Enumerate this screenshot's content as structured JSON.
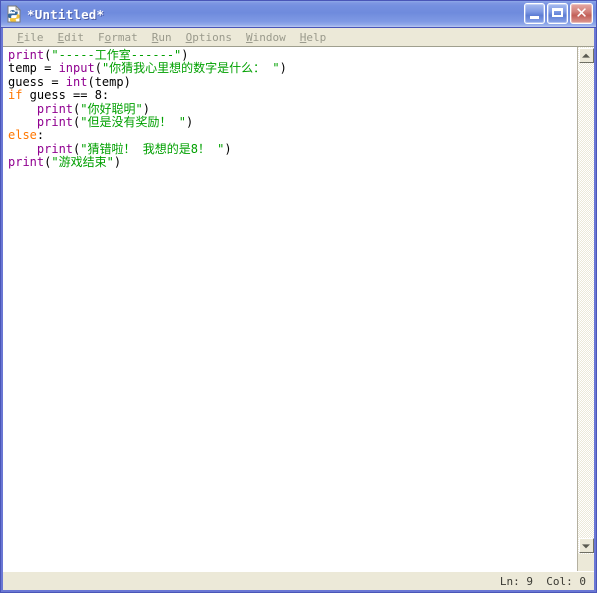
{
  "window": {
    "title": "*Untitled*",
    "icon": "python-idle-icon",
    "caption_buttons": [
      {
        "name": "minimize-button",
        "glyph": "_"
      },
      {
        "name": "maximize-button",
        "glyph": "□"
      },
      {
        "name": "close-button",
        "glyph": "✕"
      }
    ]
  },
  "menubar": {
    "items": [
      {
        "label": "File",
        "accel": "F"
      },
      {
        "label": "Edit",
        "accel": "E"
      },
      {
        "label": "Format",
        "accel": "o"
      },
      {
        "label": "Run",
        "accel": "R"
      },
      {
        "label": "Options",
        "accel": "O"
      },
      {
        "label": "Window",
        "accel": "W"
      },
      {
        "label": "Help",
        "accel": "H"
      }
    ]
  },
  "editor": {
    "lines": [
      [
        {
          "t": "print",
          "c": "builtin"
        },
        {
          "t": "(",
          "c": "plain"
        },
        {
          "t": "\"-----工作室------\"",
          "c": "string"
        },
        {
          "t": ")",
          "c": "plain"
        }
      ],
      [
        {
          "t": "temp = ",
          "c": "plain"
        },
        {
          "t": "input",
          "c": "builtin"
        },
        {
          "t": "(",
          "c": "plain"
        },
        {
          "t": "\"你猜我心里想的数字是什么： \"",
          "c": "string"
        },
        {
          "t": ")",
          "c": "plain"
        }
      ],
      [
        {
          "t": "guess = ",
          "c": "plain"
        },
        {
          "t": "int",
          "c": "builtin"
        },
        {
          "t": "(temp)",
          "c": "plain"
        }
      ],
      [
        {
          "t": "if",
          "c": "keyword"
        },
        {
          "t": " guess == 8:",
          "c": "plain"
        }
      ],
      [
        {
          "t": "    ",
          "c": "plain"
        },
        {
          "t": "print",
          "c": "builtin"
        },
        {
          "t": "(",
          "c": "plain"
        },
        {
          "t": "\"你好聪明\"",
          "c": "string"
        },
        {
          "t": ")",
          "c": "plain"
        }
      ],
      [
        {
          "t": "    ",
          "c": "plain"
        },
        {
          "t": "print",
          "c": "builtin"
        },
        {
          "t": "(",
          "c": "plain"
        },
        {
          "t": "\"但是没有奖励！ \"",
          "c": "string"
        },
        {
          "t": ")",
          "c": "plain"
        }
      ],
      [
        {
          "t": "else",
          "c": "keyword"
        },
        {
          "t": ":",
          "c": "plain"
        }
      ],
      [
        {
          "t": "    ",
          "c": "plain"
        },
        {
          "t": "print",
          "c": "builtin"
        },
        {
          "t": "(",
          "c": "plain"
        },
        {
          "t": "\"猜错啦！ 我想的是8！ \"",
          "c": "string"
        },
        {
          "t": ")",
          "c": "plain"
        }
      ],
      [
        {
          "t": "print",
          "c": "builtin"
        },
        {
          "t": "(",
          "c": "plain"
        },
        {
          "t": "\"游戏结束\"",
          "c": "string"
        },
        {
          "t": ")",
          "c": "plain"
        }
      ]
    ]
  },
  "statusbar": {
    "position": "Ln: 9  Col: 0"
  },
  "colors": {
    "titlebar_blue": "#7590e0",
    "frame_blue": "#6a77d4",
    "chrome_beige": "#ece9d8",
    "builtin_purple": "#900090",
    "string_green": "#00a000",
    "keyword_orange": "#ff7700",
    "text_black": "#000000"
  }
}
